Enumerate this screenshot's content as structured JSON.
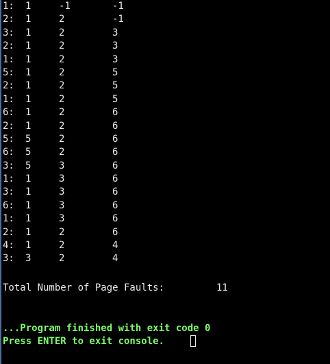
{
  "rows": [
    {
      "label": "1:",
      "f1": "1",
      "f2": "-1",
      "f3": "-1"
    },
    {
      "label": "2:",
      "f1": "1",
      "f2": "2",
      "f3": "-1"
    },
    {
      "label": "3:",
      "f1": "1",
      "f2": "2",
      "f3": "3"
    },
    {
      "label": "2:",
      "f1": "1",
      "f2": "2",
      "f3": "3"
    },
    {
      "label": "1:",
      "f1": "1",
      "f2": "2",
      "f3": "3"
    },
    {
      "label": "5:",
      "f1": "1",
      "f2": "2",
      "f3": "5"
    },
    {
      "label": "2:",
      "f1": "1",
      "f2": "2",
      "f3": "5"
    },
    {
      "label": "1:",
      "f1": "1",
      "f2": "2",
      "f3": "5"
    },
    {
      "label": "6:",
      "f1": "1",
      "f2": "2",
      "f3": "6"
    },
    {
      "label": "2:",
      "f1": "1",
      "f2": "2",
      "f3": "6"
    },
    {
      "label": "5:",
      "f1": "5",
      "f2": "2",
      "f3": "6"
    },
    {
      "label": "6:",
      "f1": "5",
      "f2": "2",
      "f3": "6"
    },
    {
      "label": "3:",
      "f1": "5",
      "f2": "3",
      "f3": "6"
    },
    {
      "label": "1:",
      "f1": "1",
      "f2": "3",
      "f3": "6"
    },
    {
      "label": "3:",
      "f1": "1",
      "f2": "3",
      "f3": "6"
    },
    {
      "label": "6:",
      "f1": "1",
      "f2": "3",
      "f3": "6"
    },
    {
      "label": "1:",
      "f1": "1",
      "f2": "3",
      "f3": "6"
    },
    {
      "label": "2:",
      "f1": "1",
      "f2": "2",
      "f3": "6"
    },
    {
      "label": "4:",
      "f1": "1",
      "f2": "2",
      "f3": "4"
    },
    {
      "label": "3:",
      "f1": "3",
      "f2": "2",
      "f3": "4"
    }
  ],
  "summary": {
    "label": "Total Number of Page Faults:",
    "value": "11"
  },
  "exit_message": "...Program finished with exit code 0",
  "prompt_text": "Press ENTER to exit console.",
  "colors": {
    "background": "#000000",
    "text": "#e8e8e8",
    "status": "#7cfc6a"
  }
}
